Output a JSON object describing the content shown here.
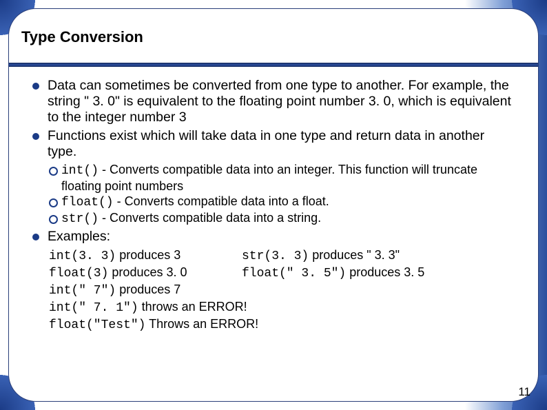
{
  "title": "Type Conversion",
  "bullets": {
    "item0": "Data can sometimes be converted from one type to another. For example, the string \" 3. 0\" is equivalent to the floating point number 3. 0, which is equivalent to the integer number 3",
    "item1": "Functions exist which will take data in one type and return data in another type.",
    "sub": {
      "int_fn": "int()",
      "int_txt": " - Converts compatible data into an integer. This function will truncate floating point numbers",
      "float_fn": "float()",
      "float_txt": " - Converts compatible data into a float.",
      "str_fn": "str()",
      "str_txt": " - Converts compatible data into a string."
    },
    "examples_label": "Examples:",
    "examples": {
      "r0a_code": "int(3. 3)",
      "r0a_txt": " produces 3",
      "r0b_code": "str(3. 3)",
      "r0b_txt": " produces \" 3. 3\"",
      "r1a_code": "float(3)",
      "r1a_txt": " produces 3. 0",
      "r1b_code": "float(\" 3. 5\")",
      "r1b_txt": " produces 3. 5",
      "r2_code": "int(\" 7\")",
      "r2_txt": " produces 7",
      "r3_code": "int(\" 7. 1\")",
      "r3_txt": "  throws an ERROR!",
      "r4_code": "float(\"Test\")",
      "r4_txt": "  Throws an ERROR!"
    }
  },
  "page_number": "11"
}
